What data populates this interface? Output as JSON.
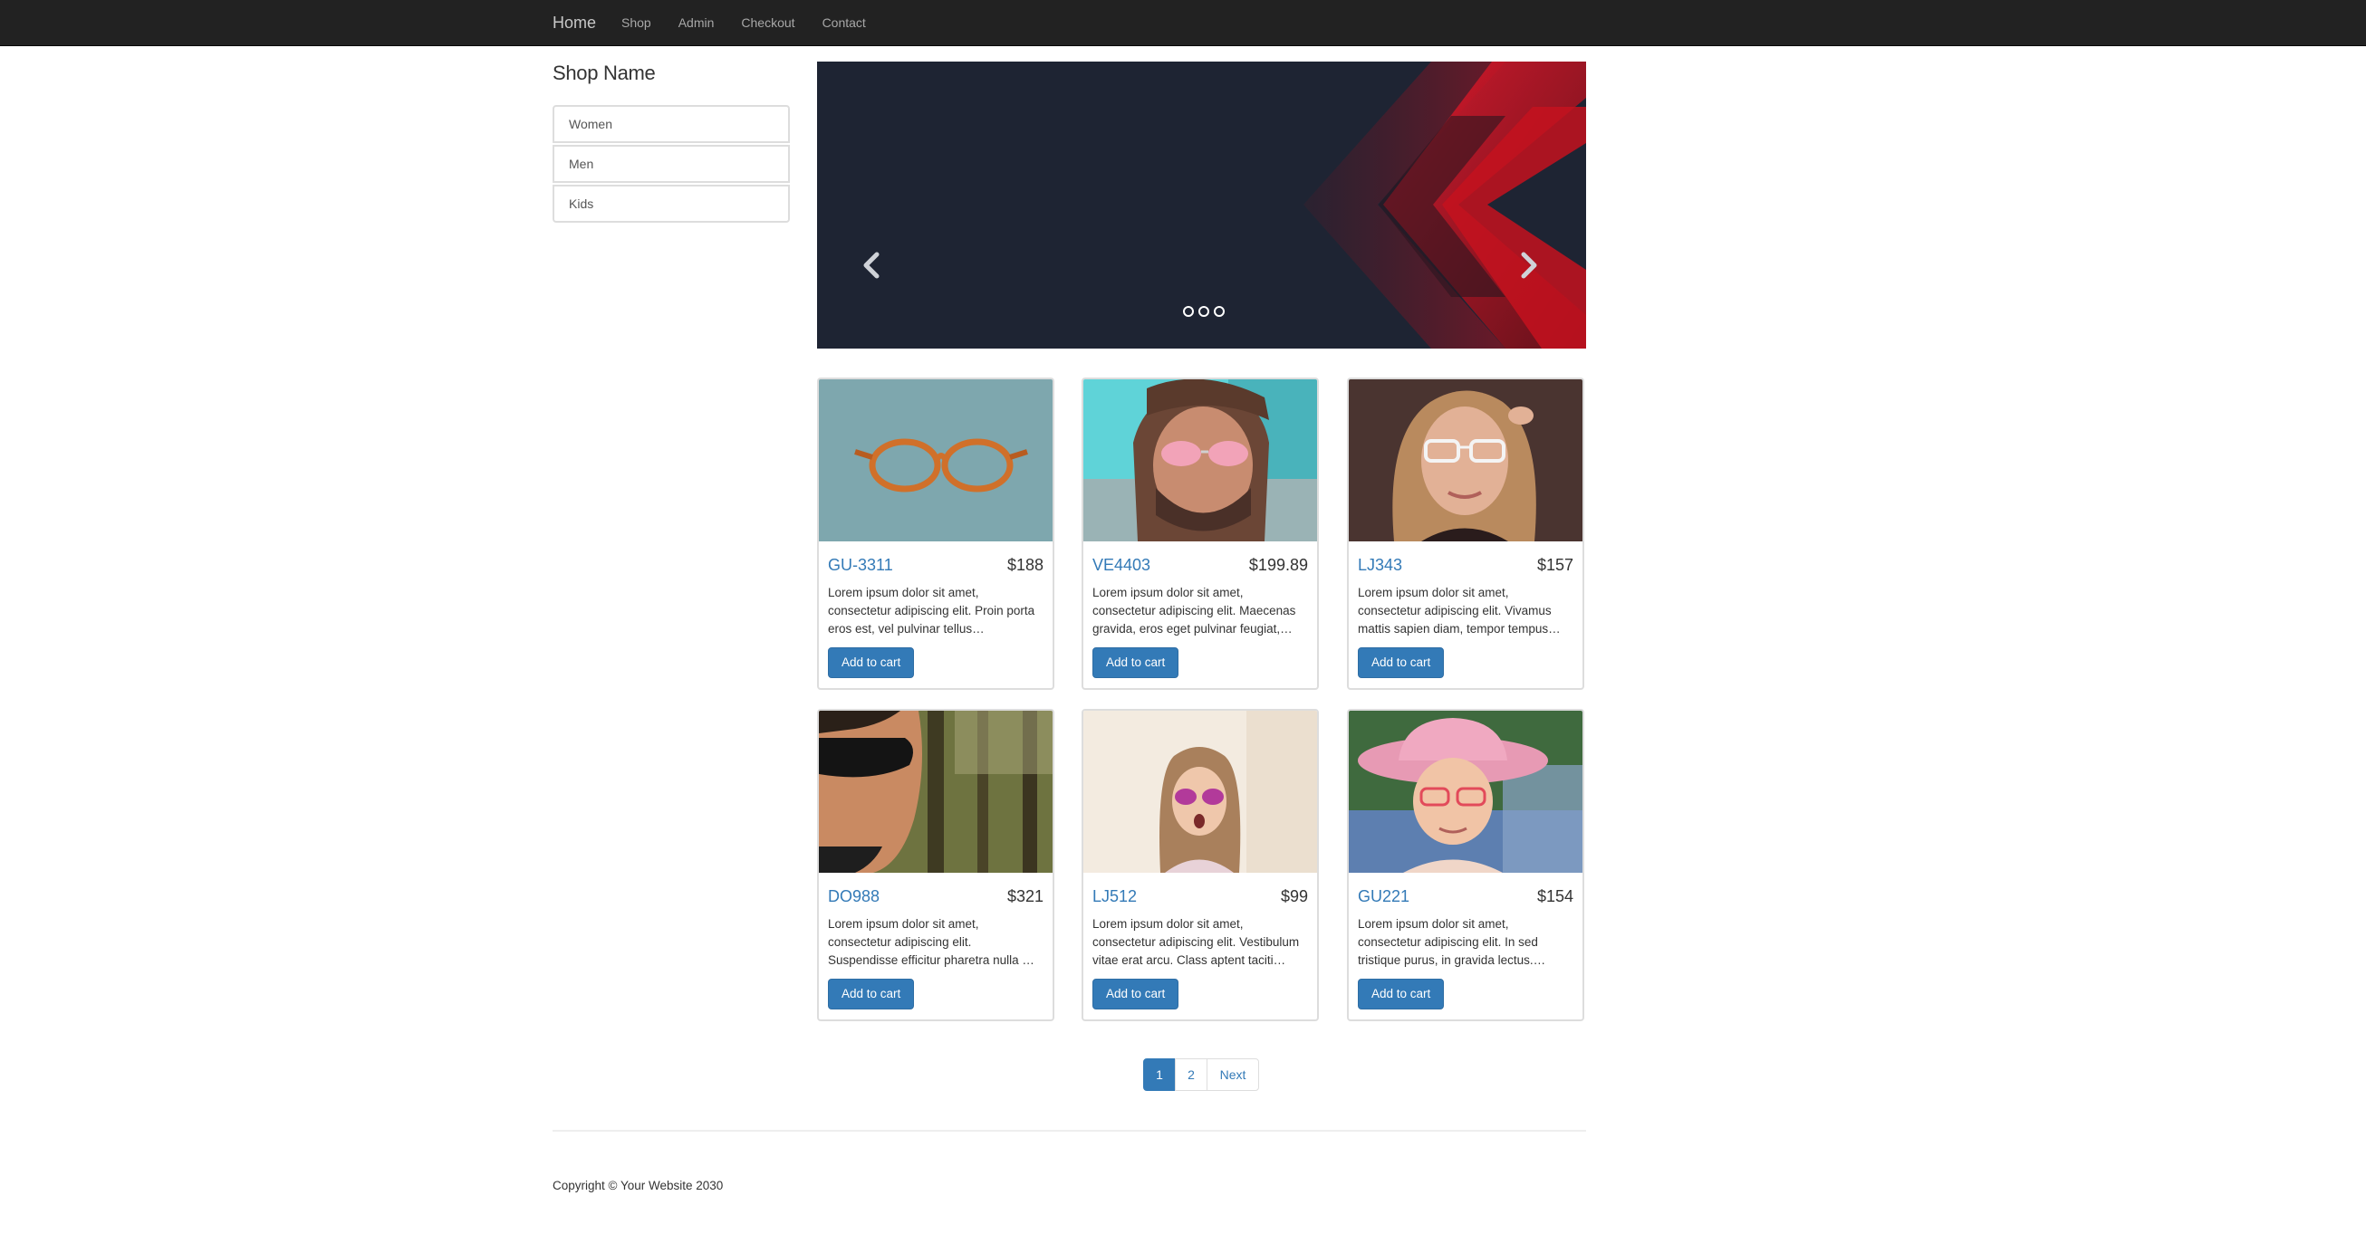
{
  "navbar": {
    "brand": "Home",
    "links": [
      "Shop",
      "Admin",
      "Checkout",
      "Contact"
    ]
  },
  "sidebar": {
    "title": "Shop Name",
    "categories": [
      "Women",
      "Men",
      "Kids"
    ]
  },
  "carousel": {
    "slide_count": 3,
    "prev_icon": "chevron-left-icon",
    "next_icon": "chevron-right-icon",
    "colors": {
      "background": "#1c2230",
      "accent": "#e8192c"
    }
  },
  "products": [
    {
      "name": "GU-3311",
      "price": "$188",
      "description": "Lorem ipsum dolor sit amet, consectetur adipiscing elit. Proin porta eros est, vel pulvinar tellus…",
      "button": "Add to cart",
      "image": "orange-eyeglasses-photo"
    },
    {
      "name": "VE4403",
      "price": "$199.89",
      "description": "Lorem ipsum dolor sit amet, consectetur adipiscing elit. Maecenas gravida, eros eget pulvinar feugiat,…",
      "button": "Add to cart",
      "image": "man-pink-sunglasses-photo"
    },
    {
      "name": "LJ343",
      "price": "$157",
      "description": "Lorem ipsum dolor sit amet, consectetur adipiscing elit. Vivamus mattis sapien diam, tempor tempus…",
      "button": "Add to cart",
      "image": "woman-white-glasses-photo"
    },
    {
      "name": "DO988",
      "price": "$321",
      "description": "Lorem ipsum dolor sit amet, consectetur adipiscing elit. Suspendisse efficitur pharetra nulla …",
      "button": "Add to cart",
      "image": "man-dark-sunglasses-photo"
    },
    {
      "name": "LJ512",
      "price": "$99",
      "description": "Lorem ipsum dolor sit amet, consectetur adipiscing elit. Vestibulum vitae erat arcu. Class aptent taciti…",
      "button": "Add to cart",
      "image": "girl-pink-sunglasses-photo"
    },
    {
      "name": "GU221",
      "price": "$154",
      "description": "Lorem ipsum dolor sit amet, consectetur adipiscing elit. In sed tristique purus, in gravida lectus.…",
      "button": "Add to cart",
      "image": "girl-pink-hat-photo"
    }
  ],
  "pagination": {
    "pages": [
      "1",
      "2"
    ],
    "active": "1",
    "next": "Next"
  },
  "footer": {
    "copyright": "Copyright © Your Website 2030"
  },
  "colors": {
    "navbar": "#222222",
    "primary": "#337ab7",
    "border": "#dddddd"
  }
}
